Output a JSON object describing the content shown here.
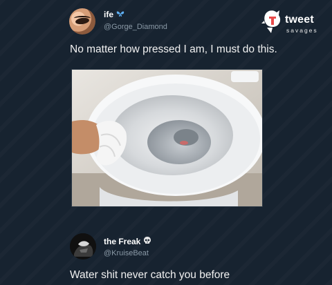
{
  "tweet1": {
    "display_name": "ife",
    "name_emoji": "butterfly-icon",
    "handle": "@Gorge_Diamond",
    "text": "No matter how pressed I am, I must do this."
  },
  "logo": {
    "word": "tweet",
    "sub": "savages",
    "accent": "#e94b4b"
  },
  "tweet2": {
    "display_name": "the Freak",
    "name_emoji": "skull-icon",
    "handle": "@KruiseBeat",
    "text": "Water shit never catch you before"
  },
  "colors": {
    "background": "#172330",
    "handle": "#8a99a6",
    "butterfly": "#5fb0f4"
  }
}
